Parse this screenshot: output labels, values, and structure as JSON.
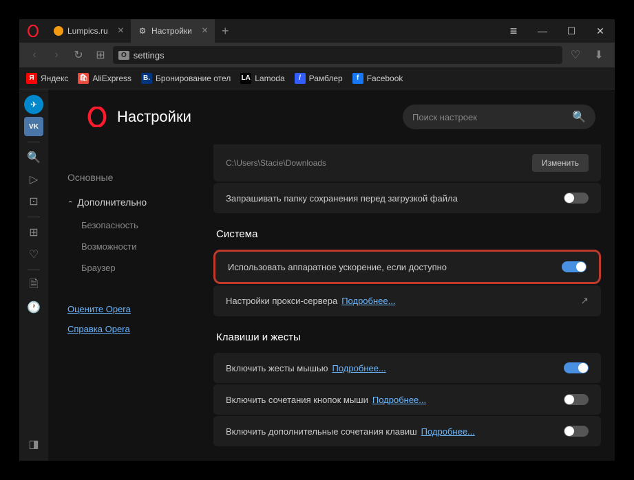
{
  "tabs": [
    {
      "label": "Lumpics.ru",
      "icon_color": "#f39c12"
    },
    {
      "label": "Настройки",
      "icon": "gear"
    }
  ],
  "url": {
    "badge": "O",
    "text": "settings"
  },
  "bookmarks": [
    {
      "label": "Яндекс",
      "icon_bg": "#ff0000",
      "icon_text": "Я"
    },
    {
      "label": "AliExpress",
      "icon_bg": "#e74c3c",
      "icon_text": ""
    },
    {
      "label": "Бронирование отел",
      "icon_bg": "#003580",
      "icon_text": "B."
    },
    {
      "label": "Lamoda",
      "icon_bg": "#000",
      "icon_text": "LA"
    },
    {
      "label": "Рамблер",
      "icon_bg": "#315efb",
      "icon_text": "/"
    },
    {
      "label": "Facebook",
      "icon_bg": "#1877f2",
      "icon_text": "f"
    }
  ],
  "settings": {
    "title": "Настройки",
    "search_placeholder": "Поиск настроек",
    "nav": {
      "main": "Основные",
      "advanced": "Дополнительно",
      "security": "Безопасность",
      "features": "Возможности",
      "browser": "Браузер",
      "rate": "Оцените Opera",
      "help": "Справка Opera"
    },
    "downloads": {
      "path": "C:\\Users\\Stacie\\Downloads",
      "change_btn": "Изменить",
      "ask_label": "Запрашивать папку сохранения перед загрузкой файла"
    },
    "system": {
      "title": "Система",
      "hw_accel": "Использовать аппаратное ускорение, если доступно",
      "proxy": "Настройки прокси-сервера",
      "learn_more": "Подробнее..."
    },
    "gestures": {
      "title": "Клавиши и жесты",
      "mouse": "Включить жесты мышью",
      "rocker": "Включить сочетания кнопок мыши",
      "advanced_kb": "Включить дополнительные сочетания клавиш",
      "learn_more": "Подробнее..."
    }
  }
}
